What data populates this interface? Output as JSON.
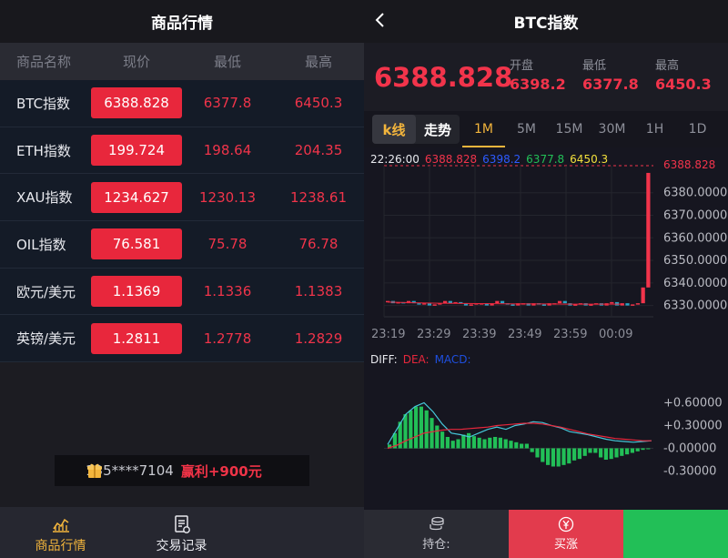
{
  "left": {
    "title": "商品行情",
    "columns": [
      "商品名称",
      "现价",
      "最低",
      "最高"
    ],
    "rows": [
      {
        "name": "BTC指数",
        "current": "6388.828",
        "low": "6377.8",
        "high": "6450.3"
      },
      {
        "name": "ETH指数",
        "current": "199.724",
        "low": "198.64",
        "high": "204.35"
      },
      {
        "name": "XAU指数",
        "current": "1234.627",
        "low": "1230.13",
        "high": "1238.61"
      },
      {
        "name": "OIL指数",
        "current": "76.581",
        "low": "75.78",
        "high": "76.78"
      },
      {
        "name": "欧元/美元",
        "current": "1.1369",
        "low": "1.1336",
        "high": "1.1383"
      },
      {
        "name": "英镑/美元",
        "current": "1.2811",
        "low": "1.2778",
        "high": "1.2829"
      }
    ],
    "notice": {
      "phone": "135****7104",
      "profit": "赢利+900元"
    },
    "tabs": [
      "商品行情",
      "交易记录"
    ]
  },
  "right": {
    "title": "BTC指数",
    "last_price": "6388.828",
    "quote": [
      {
        "label": "开盘",
        "value": "6398.2"
      },
      {
        "label": "最低",
        "value": "6377.8"
      },
      {
        "label": "最高",
        "value": "6450.3"
      }
    ],
    "mode_tabs": [
      "k线",
      "走势"
    ],
    "periods": [
      "1M",
      "5M",
      "15M",
      "30M",
      "1H",
      "1D"
    ],
    "active_period": "1M",
    "legend": {
      "time": "22:26:00",
      "v1": "6388.828",
      "v2": "6398.2",
      "v3": "6377.8",
      "v4": "6450.3"
    },
    "macd_legend": {
      "diff": "DIFF:",
      "dea": "DEA:",
      "macd": "MACD:"
    },
    "actions": {
      "hold": "持仓:",
      "rise": "买涨"
    },
    "colors": {
      "up": "#f2344b",
      "down": "#22bf57",
      "accent": "#f3b53c",
      "diff": "#46c7d9",
      "dea": "#e8273c",
      "macd": "#1e4fe0"
    }
  },
  "chart_data": [
    {
      "type": "candlestick",
      "x_ticks": [
        "23:19",
        "23:29",
        "23:39",
        "23:49",
        "23:59",
        "00:09"
      ],
      "y_ticks": [
        "6380.0000",
        "6370.0000",
        "6360.0000",
        "6350.0000",
        "6340.0000",
        "6330.0000"
      ],
      "last_label": "6388.828",
      "ylim": [
        6325,
        6392
      ],
      "candles_close": [
        6332,
        6331,
        6331.5,
        6331,
        6332,
        6331,
        6330.5,
        6331,
        6330,
        6330.5,
        6331,
        6332,
        6331,
        6331.5,
        6331,
        6330,
        6330.5,
        6331,
        6331,
        6330,
        6331,
        6332,
        6331,
        6330.5,
        6330,
        6331,
        6331,
        6330,
        6331,
        6330.5,
        6330,
        6331,
        6331,
        6332,
        6331,
        6330,
        6330.5,
        6331,
        6330,
        6330.5,
        6331,
        6330,
        6331,
        6331.5,
        6330,
        6331,
        6330,
        6330.5,
        6331,
        6338,
        6388.8
      ],
      "ma": [
        6331.5,
        6331.2,
        6331.0,
        6330.9,
        6330.8,
        6330.7,
        6330.7,
        6330.6,
        6330.6,
        6330.6
      ]
    },
    {
      "type": "bar",
      "name": "MACD",
      "y_ticks": [
        "+0.60000",
        "+0.30000",
        "-0.00000",
        "-0.30000"
      ],
      "ylim": [
        -0.45,
        0.75
      ],
      "values": [
        0.05,
        0.2,
        0.35,
        0.45,
        0.5,
        0.55,
        0.55,
        0.5,
        0.4,
        0.3,
        0.22,
        0.15,
        0.1,
        0.12,
        0.18,
        0.2,
        0.16,
        0.14,
        0.12,
        0.14,
        0.15,
        0.14,
        0.12,
        0.1,
        0.08,
        0.06,
        0.06,
        -0.05,
        -0.12,
        -0.18,
        -0.22,
        -0.24,
        -0.24,
        -0.22,
        -0.2,
        -0.16,
        -0.14,
        -0.1,
        -0.06,
        -0.06,
        -0.12,
        -0.15,
        -0.14,
        -0.12,
        -0.1,
        -0.08,
        -0.06,
        -0.04,
        -0.02,
        0.0
      ],
      "diff": [
        0.05,
        0.25,
        0.45,
        0.55,
        0.6,
        0.48,
        0.32,
        0.2,
        0.18,
        0.15,
        0.2,
        0.25,
        0.28,
        0.25,
        0.3,
        0.32,
        0.35,
        0.34,
        0.3,
        0.27,
        0.22,
        0.2,
        0.18,
        0.15,
        0.12,
        0.1,
        0.09,
        0.08,
        0.09,
        0.1
      ],
      "dea": [
        0.0,
        0.04,
        0.1,
        0.15,
        0.2,
        0.22,
        0.24,
        0.25,
        0.25,
        0.26,
        0.27,
        0.28,
        0.3,
        0.31,
        0.32,
        0.33,
        0.33,
        0.32,
        0.3,
        0.28,
        0.25,
        0.22,
        0.19,
        0.17,
        0.15,
        0.13,
        0.12,
        0.11,
        0.1,
        0.1
      ]
    }
  ]
}
